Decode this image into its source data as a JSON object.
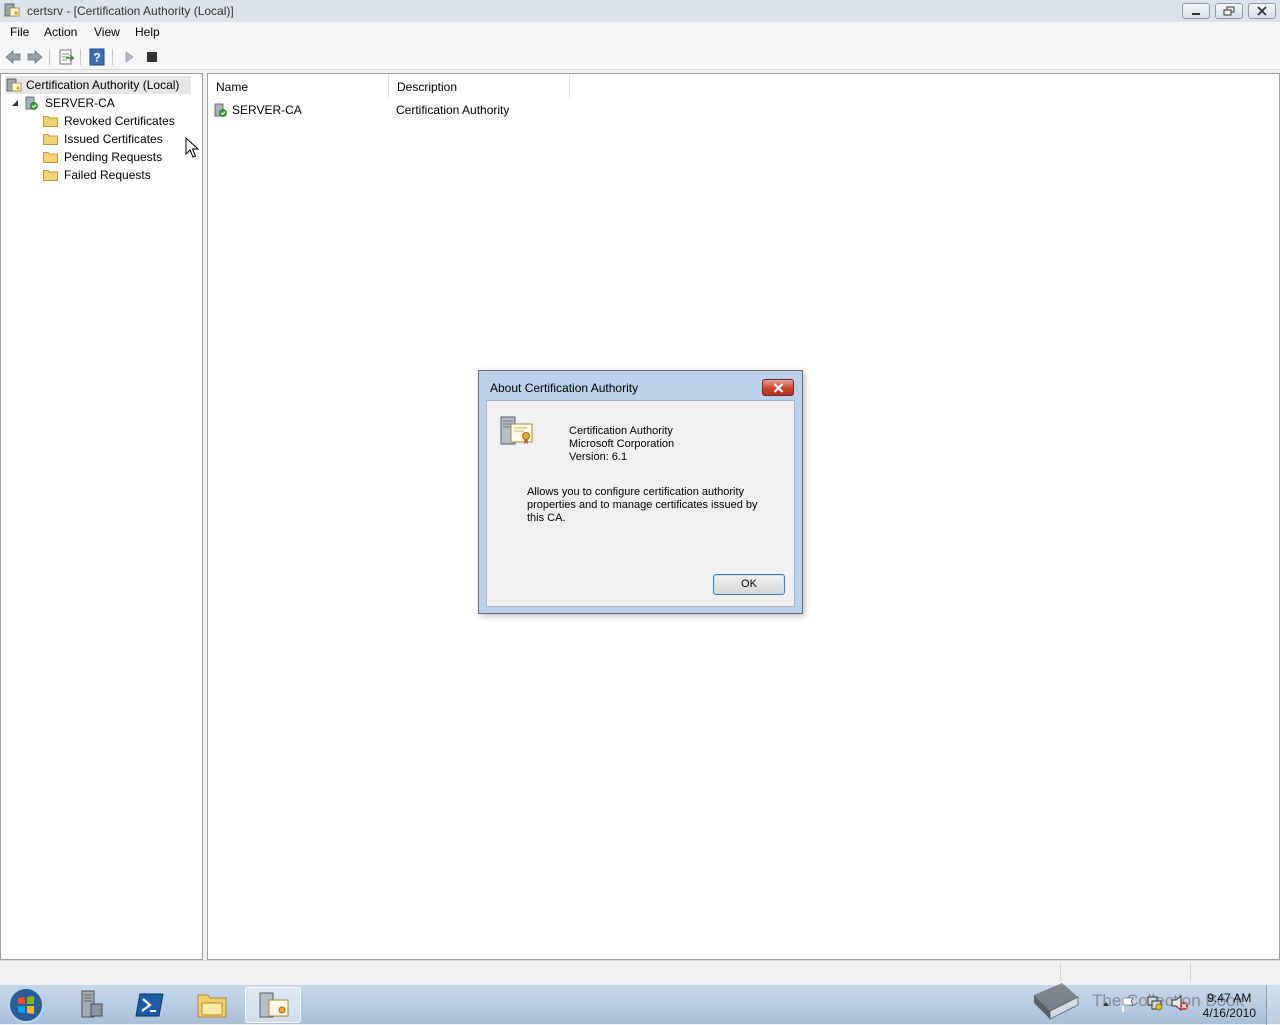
{
  "window": {
    "title": "certsrv - [Certification Authority (Local)]"
  },
  "menu": [
    "File",
    "Action",
    "View",
    "Help"
  ],
  "tree": {
    "root": "Certification Authority (Local)",
    "server": "SERVER-CA",
    "children": [
      "Revoked Certificates",
      "Issued Certificates",
      "Pending Requests",
      "Failed Requests"
    ]
  },
  "list": {
    "columns": [
      "Name",
      "Description"
    ],
    "rows": [
      {
        "name": "SERVER-CA",
        "description": "Certification Authority"
      }
    ]
  },
  "dialog": {
    "title": "About Certification Authority",
    "product": "Certification Authority",
    "company": "Microsoft Corporation",
    "version": "Version: 6.1",
    "description_lines": [
      "Allows you to configure certification authority",
      "properties and to manage certificates issued by",
      "this CA."
    ],
    "ok_label": "OK"
  },
  "taskbar": {
    "time": "9:47 AM",
    "date": "4/16/2010",
    "watermark": "The Collection Book"
  },
  "colors": {
    "accent": "#3c7fb1",
    "close": "#c7452c",
    "folder": "#f3d37a"
  }
}
